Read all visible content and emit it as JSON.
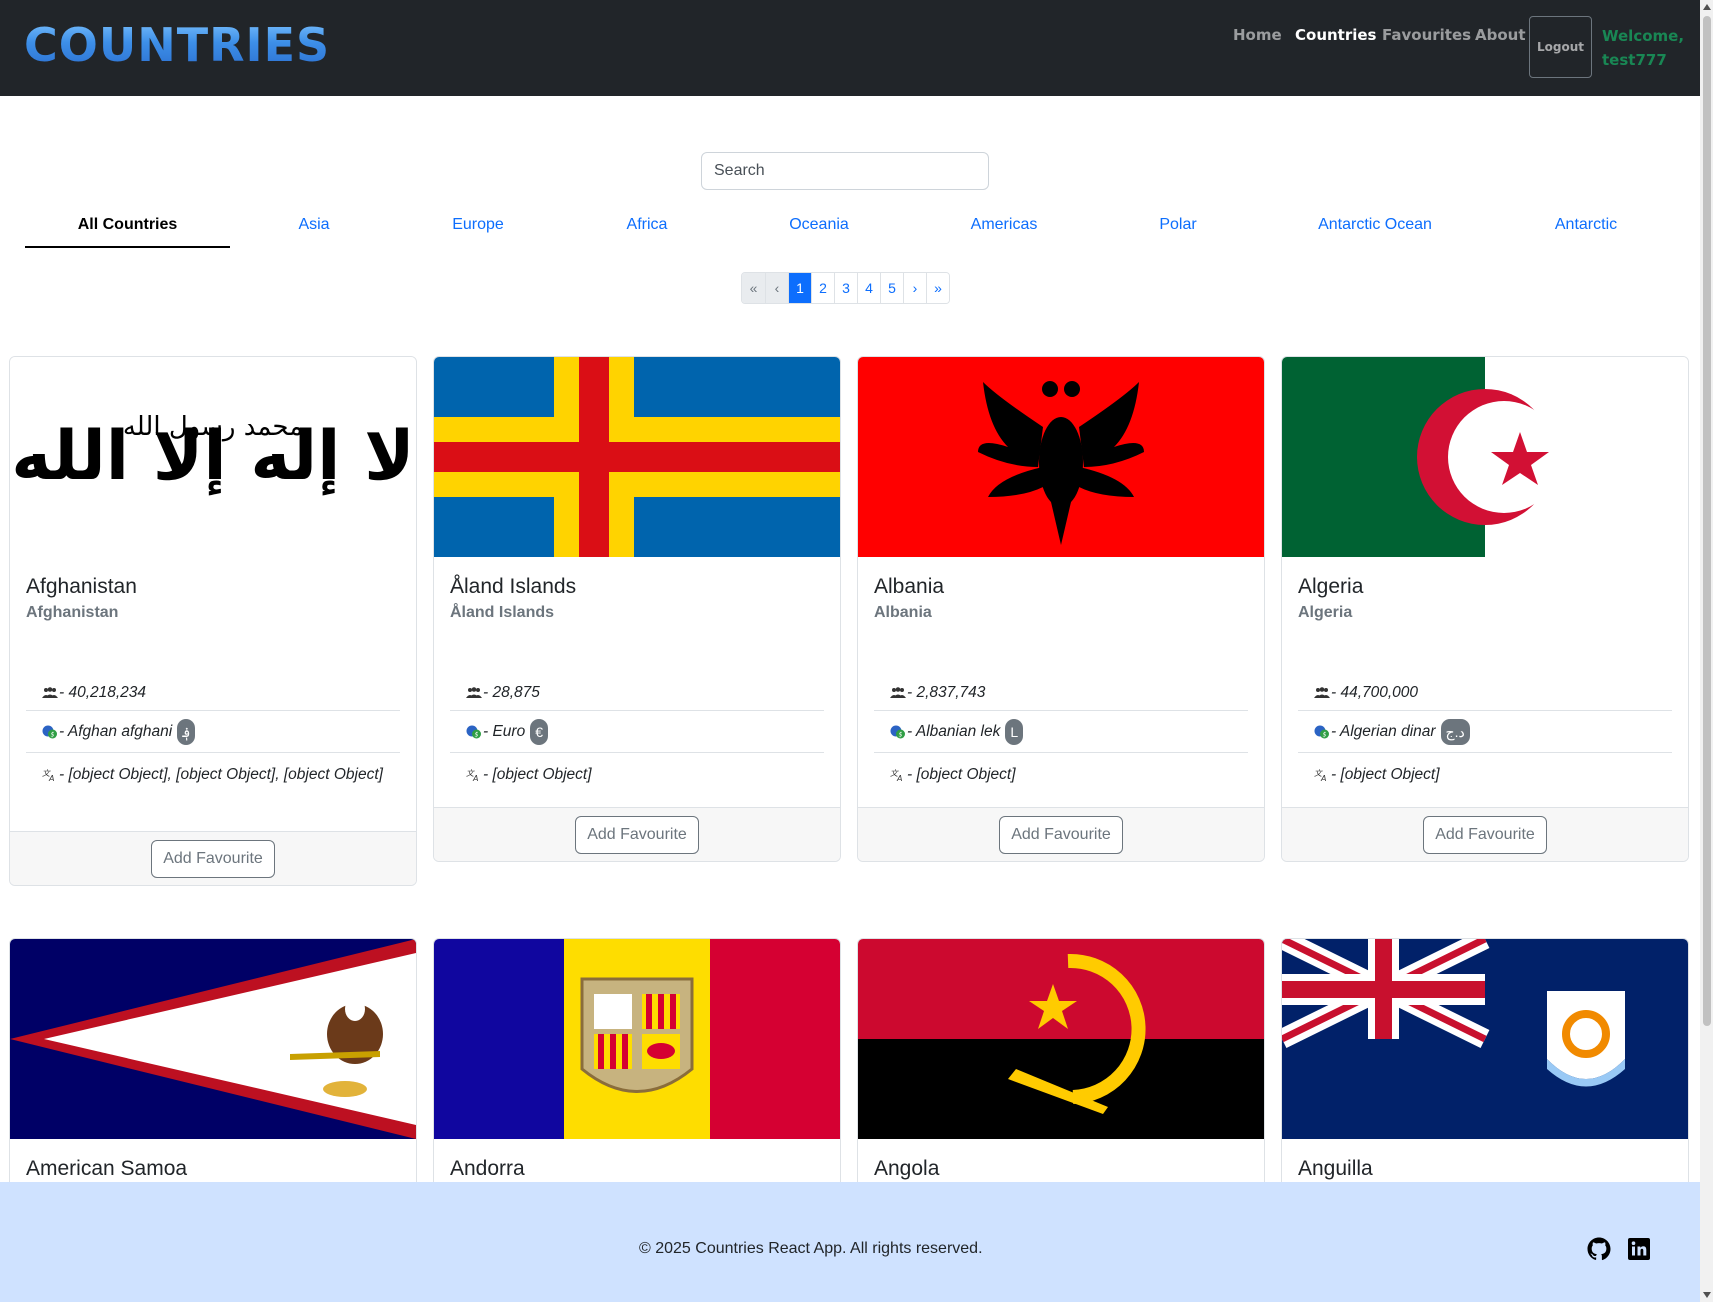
{
  "navbar": {
    "logo": "COUNTRIES",
    "links": [
      "Home",
      "Countries",
      "Favourites",
      "About"
    ],
    "active_link": "Countries",
    "logout_label": "Logout",
    "welcome_line1": "Welcome,",
    "welcome_line2": "test777"
  },
  "search": {
    "placeholder": "Search",
    "value": ""
  },
  "tabs": [
    "All Countries",
    "Asia",
    "Europe",
    "Africa",
    "Oceania",
    "Americas",
    "Polar",
    "Antarctic Ocean",
    "Antarctic"
  ],
  "active_tab": "All Countries",
  "pagination": {
    "first": "«",
    "prev": "‹",
    "pages": [
      "1",
      "2",
      "3",
      "4",
      "5"
    ],
    "current": "1",
    "next": "›",
    "last": "»"
  },
  "cards": [
    {
      "name": "Afghanistan",
      "official": "Afghanistan",
      "population": "- 40,218,234",
      "currency": "- Afghan afghani",
      "symbol": "؋",
      "languages": "- [object Object], [object Object], [object Object]",
      "button": "Add Favourite"
    },
    {
      "name": "Åland Islands",
      "official": "Åland Islands",
      "population": "- 28,875",
      "currency": "- Euro",
      "symbol": "€",
      "languages": "- [object Object]",
      "button": "Add Favourite"
    },
    {
      "name": "Albania",
      "official": "Albania",
      "population": "- 2,837,743",
      "currency": "- Albanian lek",
      "symbol": "L",
      "languages": "- [object Object]",
      "button": "Add Favourite"
    },
    {
      "name": "Algeria",
      "official": "Algeria",
      "population": "- 44,700,000",
      "currency": "- Algerian dinar",
      "symbol": "د.ج",
      "languages": "- [object Object]",
      "button": "Add Favourite"
    },
    {
      "name": "American Samoa"
    },
    {
      "name": "Andorra"
    },
    {
      "name": "Angola"
    },
    {
      "name": "Anguilla"
    }
  ],
  "icons": {
    "population": "people-icon",
    "currency": "coins-icon",
    "language": "translate-icon",
    "github": "github-icon",
    "linkedin": "linkedin-icon"
  },
  "colors": {
    "navbar": "#212529",
    "primary": "#0d6efd",
    "welcome": "#198754",
    "footer": "#cfe2ff"
  },
  "footer": {
    "copyright": "© 2025 Countries React App. All rights reserved."
  }
}
